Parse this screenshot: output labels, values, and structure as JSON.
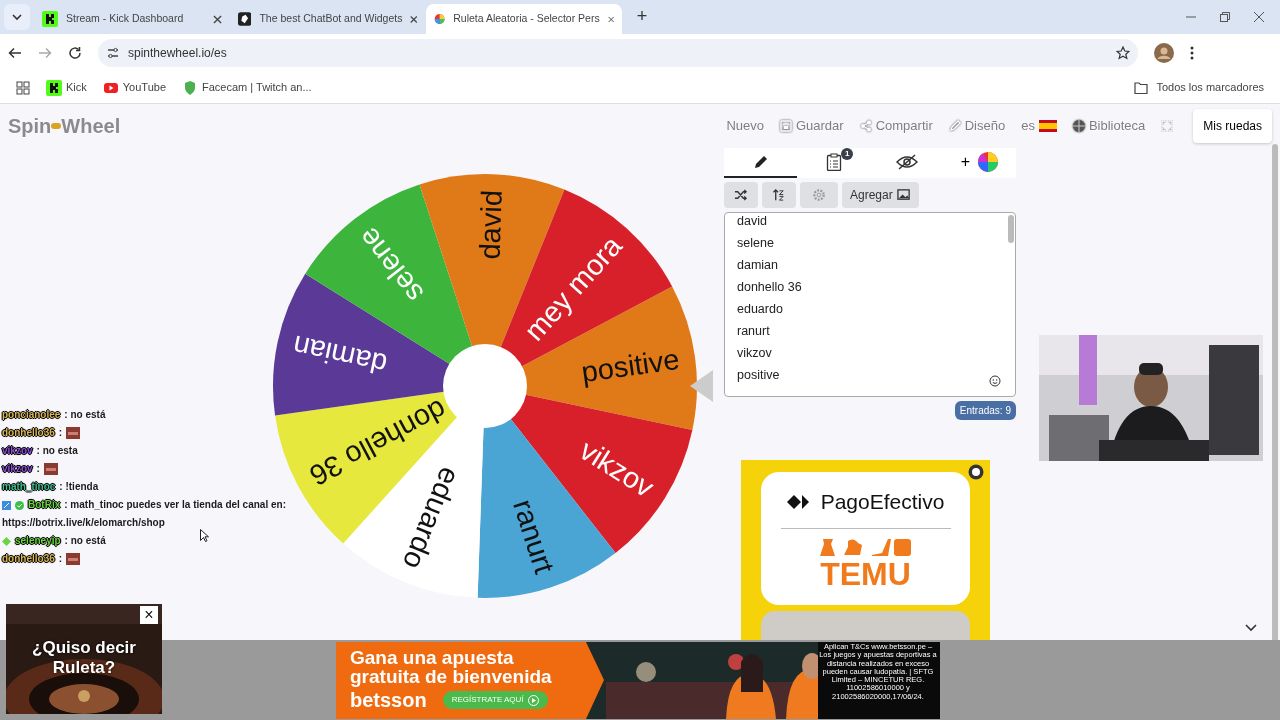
{
  "browser": {
    "tabs": [
      {
        "title": "Stream - Kick Dashboard",
        "kind": "kick",
        "selected": false
      },
      {
        "title": "The best ChatBot and Widgets",
        "kind": "bot",
        "selected": false
      },
      {
        "title": "Ruleta Aleatoria - Selector Pers",
        "kind": "wheel",
        "selected": true
      }
    ],
    "new_tab": "+",
    "address": "spinthewheel.io/es",
    "bookmarks": [
      {
        "label": "Kick",
        "kind": "kick"
      },
      {
        "label": "YouTube",
        "kind": "youtube"
      },
      {
        "label": "Facecam | Twitch an...",
        "kind": "shield"
      }
    ],
    "all_bookmarks": "Todos los marcadores"
  },
  "site": {
    "logo": [
      "Spin",
      "Wheel"
    ],
    "nav": [
      {
        "label": "Nuevo",
        "kind": "text"
      },
      {
        "label": "Guardar",
        "kind": "save"
      },
      {
        "label": "Compartir",
        "kind": "share"
      },
      {
        "label": "Diseño",
        "kind": "pencil"
      },
      {
        "label": "es",
        "kind": "flag"
      },
      {
        "label": "Biblioteca",
        "kind": "library"
      },
      {
        "kind": "fullscreen"
      }
    ],
    "my_wheels": "Mis ruedas"
  },
  "wheel": {
    "segments": [
      {
        "label": "positive",
        "color": "#e07a18"
      },
      {
        "label": "vikzov",
        "color": "#d8202a"
      },
      {
        "label": "ranurt",
        "color": "#4aa5d5"
      },
      {
        "label": "eduardo",
        "color": "#ffffff"
      },
      {
        "label": "donhello 36",
        "color": "#e6e83e"
      },
      {
        "label": "damian",
        "color": "#5a3a96"
      },
      {
        "label": "selene",
        "color": "#3db53d"
      },
      {
        "label": "david",
        "color": "#e07a18"
      },
      {
        "label": "mey mora",
        "color": "#d8202a"
      }
    ]
  },
  "panel": {
    "tabs": [
      {
        "kind": "edit",
        "selected": true
      },
      {
        "kind": "results",
        "badge": "1",
        "selected": false
      },
      {
        "kind": "hidden",
        "selected": false
      },
      {
        "kind": "add",
        "label": "+",
        "selected": false
      }
    ],
    "tools": [
      {
        "kind": "shuffle"
      },
      {
        "kind": "sort"
      },
      {
        "kind": "settings"
      },
      {
        "kind": "add-image",
        "label": "Agregar"
      }
    ],
    "entries": [
      "david",
      "selene",
      "damian",
      "donhello 36",
      "eduardo",
      "ranurt",
      "vikzov",
      "positive"
    ],
    "count": "Entradas: 9"
  },
  "chat": [
    {
      "user": "poncianolee",
      "color": "#d9b65a",
      "text": ": no está"
    },
    {
      "user": "donhello36",
      "color": "#d9b65a",
      "text": ":",
      "emote": true
    },
    {
      "user": "vikzov",
      "color": "#8d4fd6",
      "text": ": no esta"
    },
    {
      "user": "vikzov",
      "color": "#8d4fd6",
      "text": ":",
      "emote": true
    },
    {
      "user": "math_tinoc",
      "color": "#3fbf8f",
      "text": ": !tienda"
    },
    {
      "user": "BotRix",
      "color": "#6bd443",
      "text": ": math_tinoc puedes ver la tienda del canal en:",
      "bot": true
    },
    {
      "text": "https://botrix.live/k/elomarch/shop"
    },
    {
      "user": "seleneyip",
      "color": "#6bd443",
      "text": ": no está",
      "diamond": true
    },
    {
      "user": "donhello36",
      "color": "#d9b65a",
      "text": ":",
      "emote": true
    }
  ],
  "ads": {
    "side": {
      "brand": "PagoEfectivo",
      "store": "TEMU"
    },
    "banner": {
      "headline": [
        "Gana una apuesta",
        "gratuita de bienvenida"
      ],
      "brand": "betsson",
      "cta": "REGÍSTRATE AQUÍ",
      "legal": "Aplican T&Cs www.betsson.pe – Los juegos y apuestas deportivas a distancia realizados en exceso pueden causar ludopatía. | SFTG Limited – MINCETUR REG. 11002586010000 y 21002586020000,17/06/24."
    },
    "popup": {
      "text": "¿Quiso decir Ruleta?",
      "close": "×"
    }
  }
}
